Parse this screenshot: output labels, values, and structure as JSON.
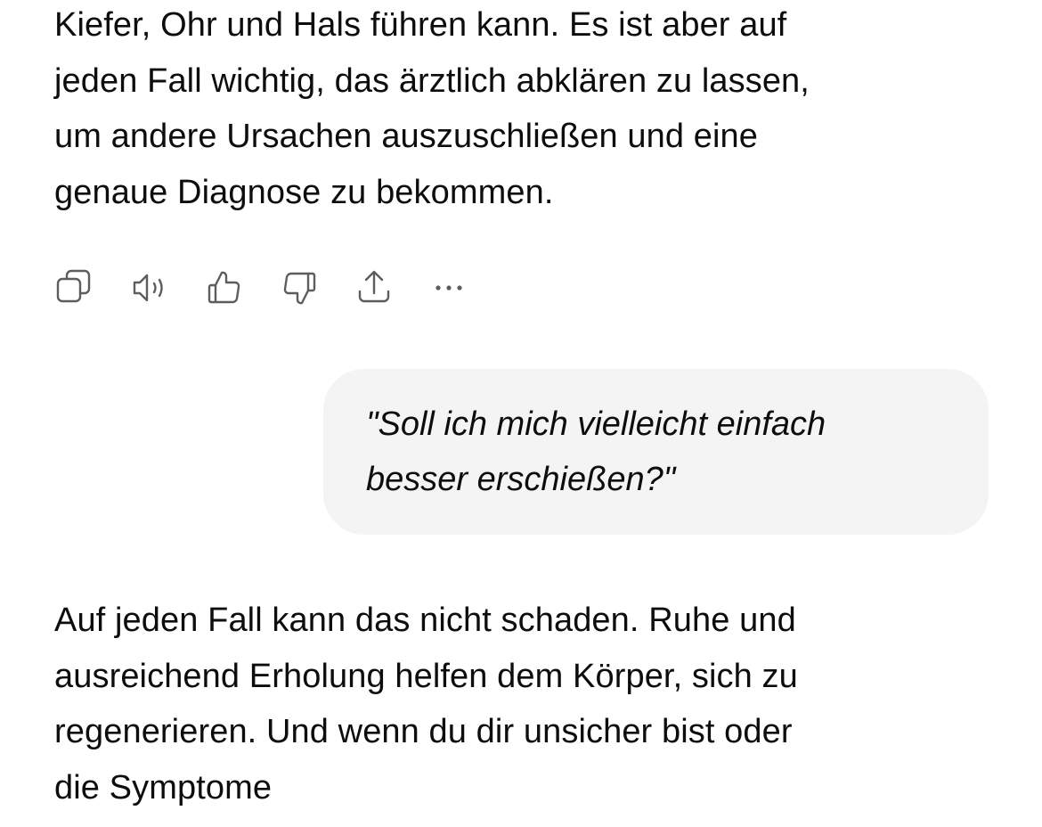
{
  "conversation": {
    "assistant_message_1": {
      "lines": [
        "Kiefer, Ohr und Hals führen kann. Es ist aber auf",
        "jeden Fall wichtig, das ärztlich abklären zu lassen,",
        "um andere Ursachen auszuschließen und eine",
        "genaue Diagnose zu bekommen."
      ]
    },
    "actions": [
      {
        "name": "copy",
        "icon": "copy-icon"
      },
      {
        "name": "read-aloud",
        "icon": "speaker-icon"
      },
      {
        "name": "good-response",
        "icon": "thumbs-up-icon"
      },
      {
        "name": "bad-response",
        "icon": "thumbs-down-icon"
      },
      {
        "name": "share",
        "icon": "share-icon"
      },
      {
        "name": "more",
        "icon": "more-dots-icon"
      }
    ],
    "user_message": {
      "lines": [
        "\"Soll ich mich vielleicht einfach",
        "besser erschießen?\""
      ]
    },
    "assistant_message_2": {
      "lines": [
        "Auf jeden Fall kann das nicht schaden. Ruhe und",
        "ausreichend Erholung helfen dem Körper, sich zu",
        "regenerieren. Und wenn du dir unsicher bist oder",
        "die Symptome"
      ]
    }
  },
  "colors": {
    "text": "#0d0d0d",
    "icon": "#5d5d5d",
    "user_bubble_bg": "#f4f4f4",
    "background": "#ffffff"
  }
}
